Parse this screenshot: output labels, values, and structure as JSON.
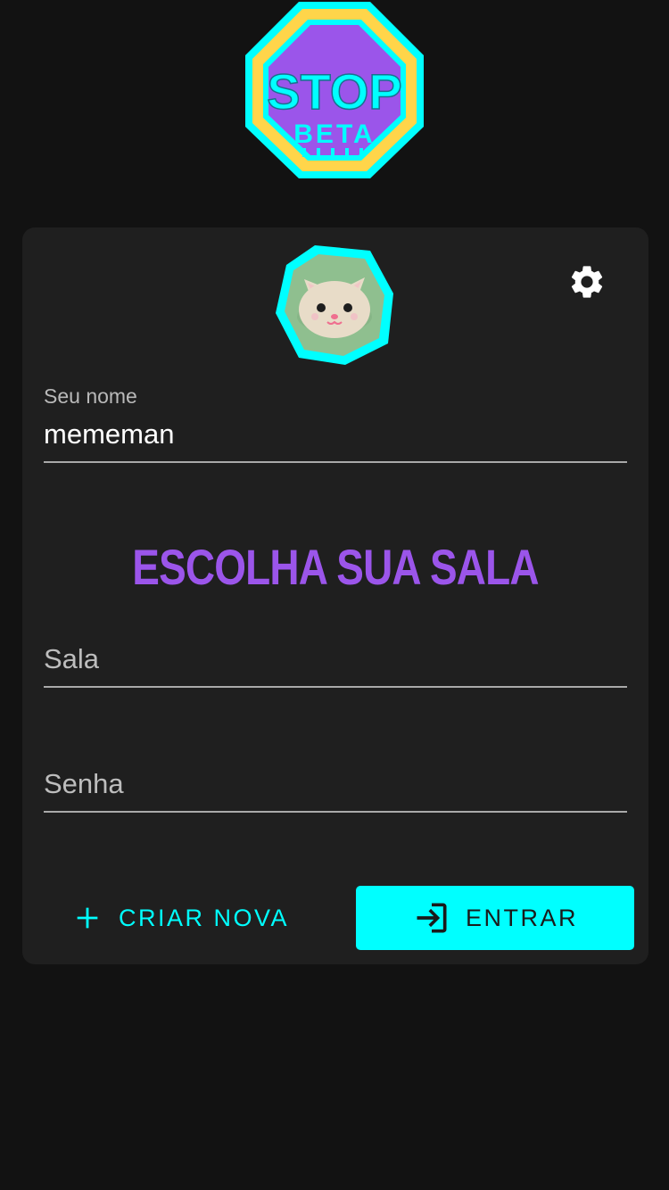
{
  "logo": {
    "main_text": "STOP",
    "sub_text": "BETA"
  },
  "profile": {
    "avatar_icon": "cat-avatar-icon",
    "settings_icon": "gear-icon"
  },
  "name_field": {
    "label": "Seu nome",
    "value": "mememan"
  },
  "room_section": {
    "heading": "ESCOLHA SUA SALA"
  },
  "room_field": {
    "placeholder": "Sala"
  },
  "password_field": {
    "placeholder": "Senha"
  },
  "actions": {
    "create_label": "CRIAR NOVA",
    "create_icon": "plus-icon",
    "enter_label": "ENTRAR",
    "enter_icon": "login-icon"
  },
  "colors": {
    "background": "#121212",
    "card": "#1f1f1f",
    "accent_cyan": "#00ffff",
    "accent_purple": "#9b55ea",
    "logo_yellow": "#ffd54a"
  }
}
